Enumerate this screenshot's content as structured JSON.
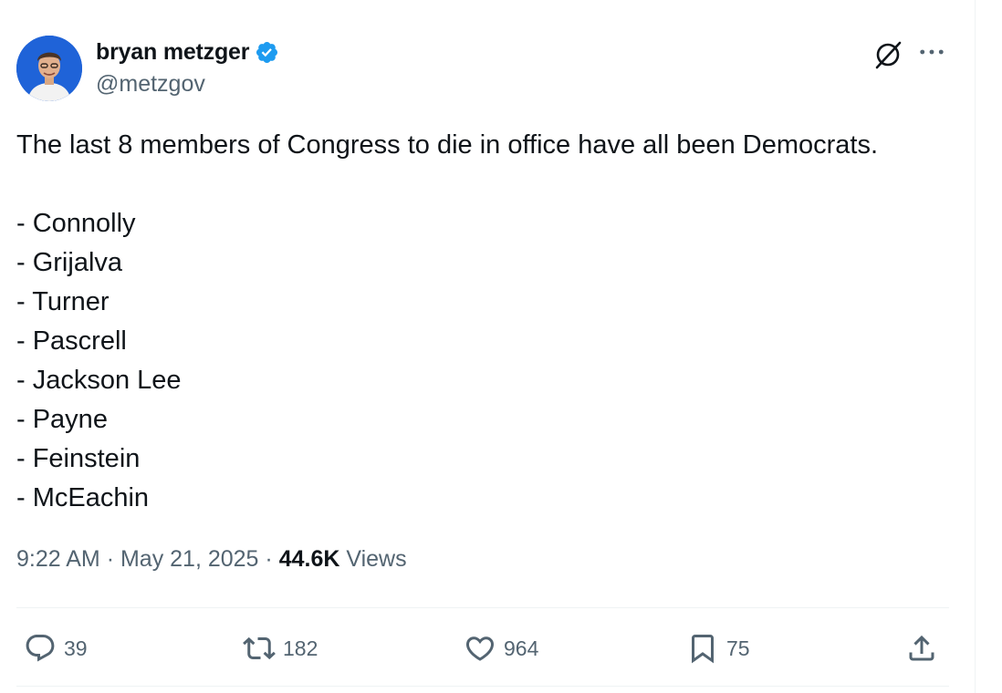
{
  "author": {
    "display_name": "bryan metzger",
    "handle": "@metzgov",
    "verified": true,
    "verified_color": "#1d9bf0"
  },
  "header_icons": [
    "grok-icon",
    "more-icon"
  ],
  "tweet": {
    "lines": [
      "The last 8 members of Congress to die in office have all been Democrats.",
      "",
      "- Connolly",
      "- Grijalva",
      "- Turner",
      "- Pascrell",
      "- Jackson Lee",
      "- Payne",
      "- Feinstein",
      "- McEachin"
    ]
  },
  "meta": {
    "time": "9:22 AM",
    "separator": "·",
    "date": "May 21, 2025",
    "views_count": "44.6K",
    "views_label": "Views"
  },
  "actions": {
    "replies": "39",
    "reposts": "182",
    "likes": "964",
    "bookmarks": "75"
  },
  "colors": {
    "text": "#0f1419",
    "secondary": "#536471",
    "divider": "#eff3f4"
  }
}
